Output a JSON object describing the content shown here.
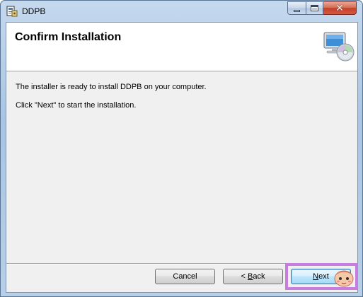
{
  "window": {
    "title": "DDPB",
    "close_symbol": "✕"
  },
  "header": {
    "title": "Confirm Installation",
    "icon": "computer-cd-icon"
  },
  "body": {
    "line1": "The installer is ready to install DDPB on your computer.",
    "line2": "Click \"Next\" to start the installation."
  },
  "buttons": {
    "cancel": "Cancel",
    "back_arrow": "< ",
    "back_key": "B",
    "back_rest": "ack",
    "next_key": "N",
    "next_rest": "ext"
  },
  "colors": {
    "highlight": "#c77ce0",
    "close_button": "#c4402a",
    "default_button_border": "#3c7fb1"
  }
}
